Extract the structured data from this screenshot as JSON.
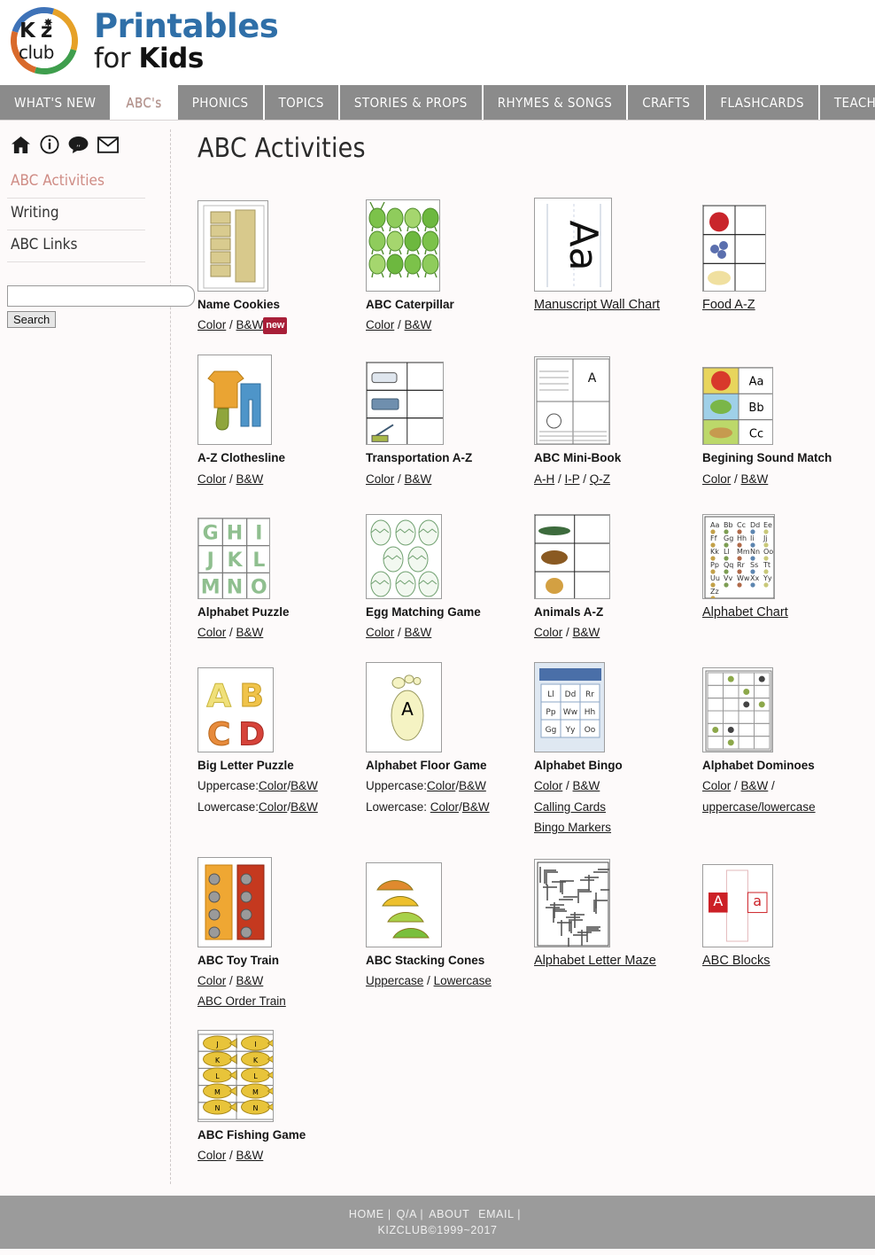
{
  "brand": {
    "logo_k": "K z",
    "logo_i": "i",
    "logo_club": "club",
    "title_line1": "Printables",
    "title_line2_thin": "for ",
    "title_line2_bold": "Kids"
  },
  "nav": {
    "items": [
      {
        "label": "WHAT'S NEW",
        "active": false
      },
      {
        "label": "ABC's",
        "active": true
      },
      {
        "label": "PHONICS",
        "active": false
      },
      {
        "label": "TOPICS",
        "active": false
      },
      {
        "label": "STORIES & PROPS",
        "active": false
      },
      {
        "label": "RHYMES & SONGS",
        "active": false
      },
      {
        "label": "CRAFTS",
        "active": false
      },
      {
        "label": "FLASHCARDS",
        "active": false
      },
      {
        "label": "TEACHING EXT",
        "active": false
      }
    ]
  },
  "sidebar": {
    "icons": [
      "home-icon",
      "info-icon",
      "comment-icon",
      "mail-icon"
    ],
    "links": [
      {
        "label": "ABC Activities",
        "active": true
      },
      {
        "label": "Writing",
        "active": false
      },
      {
        "label": "ABC Links",
        "active": false
      }
    ],
    "search": {
      "value": "",
      "placeholder": "",
      "button": "Search"
    }
  },
  "main": {
    "title": "ABC Activities",
    "items": [
      {
        "title": "Name Cookies",
        "title_is_link": false,
        "link_lines": [
          [
            {
              "t": "Color",
              "link": true
            },
            {
              "t": " / ",
              "link": false
            },
            {
              "t": "B&W",
              "link": true
            },
            {
              "t": "new",
              "badge": true
            }
          ]
        ]
      },
      {
        "title": "ABC Caterpillar",
        "title_is_link": false,
        "link_lines": [
          [
            {
              "t": "Color",
              "link": true
            },
            {
              "t": " / ",
              "link": false
            },
            {
              "t": "B&W",
              "link": true
            }
          ]
        ]
      },
      {
        "title": "Manuscript Wall Chart",
        "title_is_link": true,
        "link_lines": []
      },
      {
        "title": "Food A-Z",
        "title_is_link": true,
        "link_lines": []
      },
      {
        "title": "A-Z Clothesline",
        "title_is_link": false,
        "link_lines": [
          [
            {
              "t": "Color",
              "link": true
            },
            {
              "t": " / ",
              "link": false
            },
            {
              "t": "B&W",
              "link": true
            }
          ]
        ]
      },
      {
        "title": "Transportation A-Z",
        "title_is_link": false,
        "link_lines": [
          [
            {
              "t": "Color",
              "link": true
            },
            {
              "t": " / ",
              "link": false
            },
            {
              "t": "B&W",
              "link": true
            }
          ]
        ]
      },
      {
        "title": "ABC Mini-Book",
        "title_is_link": false,
        "link_lines": [
          [
            {
              "t": "A-H",
              "link": true
            },
            {
              "t": " / ",
              "link": false
            },
            {
              "t": "I-P",
              "link": true
            },
            {
              "t": " / ",
              "link": false
            },
            {
              "t": "Q-Z",
              "link": true
            }
          ]
        ]
      },
      {
        "title": "Begining Sound Match",
        "title_is_link": false,
        "link_lines": [
          [
            {
              "t": "Color",
              "link": true
            },
            {
              "t": " / ",
              "link": false
            },
            {
              "t": "B&W",
              "link": true
            }
          ]
        ]
      },
      {
        "title": "Alphabet Puzzle",
        "title_is_link": false,
        "link_lines": [
          [
            {
              "t": "Color",
              "link": true
            },
            {
              "t": " / ",
              "link": false
            },
            {
              "t": "B&W",
              "link": true
            }
          ]
        ]
      },
      {
        "title": "Egg Matching Game",
        "title_is_link": false,
        "link_lines": [
          [
            {
              "t": "Color",
              "link": true
            },
            {
              "t": " / ",
              "link": false
            },
            {
              "t": "B&W",
              "link": true
            }
          ]
        ]
      },
      {
        "title": "Animals A-Z",
        "title_is_link": false,
        "link_lines": [
          [
            {
              "t": "Color",
              "link": true
            },
            {
              "t": " / ",
              "link": false
            },
            {
              "t": "B&W",
              "link": true
            }
          ]
        ]
      },
      {
        "title": "Alphabet Chart",
        "title_is_link": true,
        "link_lines": []
      },
      {
        "title": "Big Letter Puzzle",
        "title_is_link": false,
        "link_lines": [
          [
            {
              "t": "Uppercase:",
              "link": false
            },
            {
              "t": "Color",
              "link": true
            },
            {
              "t": "/",
              "link": false
            },
            {
              "t": "B&W",
              "link": true
            }
          ],
          [
            {
              "t": "Lowercase:",
              "link": false
            },
            {
              "t": "Color",
              "link": true
            },
            {
              "t": "/",
              "link": false
            },
            {
              "t": "B&W",
              "link": true
            }
          ]
        ]
      },
      {
        "title": "Alphabet Floor Game",
        "title_is_link": false,
        "link_lines": [
          [
            {
              "t": "Uppercase:",
              "link": false
            },
            {
              "t": "Color",
              "link": true
            },
            {
              "t": "/",
              "link": false
            },
            {
              "t": "B&W",
              "link": true
            }
          ],
          [
            {
              "t": "Lowercase: ",
              "link": false
            },
            {
              "t": "Color",
              "link": true
            },
            {
              "t": "/",
              "link": false
            },
            {
              "t": "B&W",
              "link": true
            }
          ]
        ]
      },
      {
        "title": "Alphabet Bingo",
        "title_is_link": false,
        "link_lines": [
          [
            {
              "t": "Color",
              "link": true
            },
            {
              "t": " / ",
              "link": false
            },
            {
              "t": "B&W",
              "link": true
            }
          ],
          [
            {
              "t": "Calling Cards",
              "link": true
            }
          ],
          [
            {
              "t": "Bingo Markers",
              "link": true
            }
          ]
        ]
      },
      {
        "title": "Alphabet Dominoes",
        "title_is_link": false,
        "link_lines": [
          [
            {
              "t": "Color",
              "link": true
            },
            {
              "t": " / ",
              "link": false
            },
            {
              "t": "B&W",
              "link": true
            },
            {
              "t": " / ",
              "link": false
            }
          ],
          [
            {
              "t": "uppercase/lowercase",
              "link": true
            }
          ]
        ]
      },
      {
        "title": "ABC Toy Train",
        "title_is_link": false,
        "link_lines": [
          [
            {
              "t": "Color",
              "link": true
            },
            {
              "t": " / ",
              "link": false
            },
            {
              "t": "B&W",
              "link": true
            }
          ],
          [
            {
              "t": "ABC Order Train",
              "link": true
            }
          ]
        ]
      },
      {
        "title": "ABC Stacking Cones",
        "title_is_link": false,
        "link_lines": [
          [
            {
              "t": "Uppercase",
              "link": true
            },
            {
              "t": " / ",
              "link": false
            },
            {
              "t": "Lowercase",
              "link": true
            }
          ]
        ]
      },
      {
        "title": "Alphabet Letter Maze",
        "title_is_link": true,
        "link_lines": []
      },
      {
        "title": "ABC Blocks",
        "title_is_link": true,
        "link_lines": []
      },
      {
        "title": "ABC Fishing Game",
        "title_is_link": false,
        "link_lines": [
          [
            {
              "t": "Color",
              "link": true
            },
            {
              "t": " / ",
              "link": false
            },
            {
              "t": "B&W",
              "link": true
            }
          ]
        ]
      }
    ]
  },
  "footer": {
    "links": [
      "HOME |",
      "Q/A |",
      "ABOUT ",
      "EMAIL |"
    ],
    "copyright": "KIZCLUB©1999~2017"
  }
}
